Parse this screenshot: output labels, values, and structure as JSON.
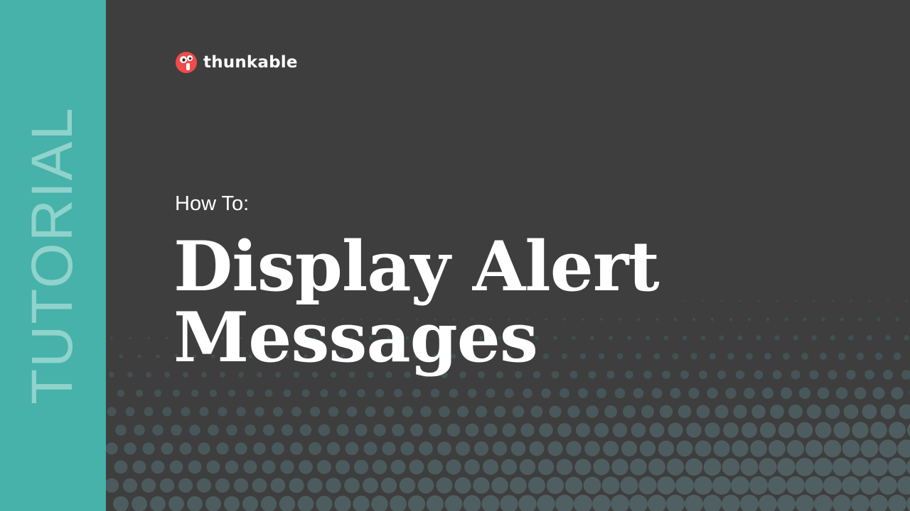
{
  "brand": {
    "name": "thunkable",
    "accent_color": "#ef4b4b",
    "side_band_color": "#46b2a9",
    "background_color": "#3e3e3e"
  },
  "side_label": "TUTORIAL",
  "eyebrow": "How To:",
  "headline": {
    "line1": "Display Alert",
    "line2": "Messages"
  },
  "icons": [
    "thunkable-logo-icon"
  ]
}
